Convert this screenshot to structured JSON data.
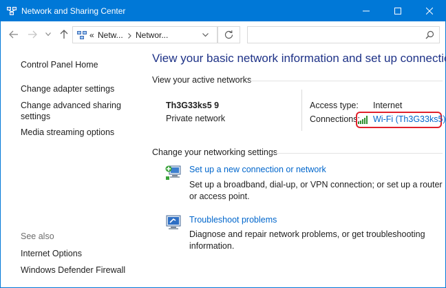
{
  "window": {
    "title": "Network and Sharing Center",
    "accent": "#0078d7"
  },
  "address": {
    "prefix": "«",
    "crumb1": "Netw...",
    "crumb2": "Networ...",
    "search_placeholder": ""
  },
  "sidebar": {
    "items": [
      {
        "label": "Control Panel Home"
      },
      {
        "label": "Change adapter settings"
      },
      {
        "label": "Change advanced sharing settings"
      },
      {
        "label": "Media streaming options"
      }
    ],
    "see_also": "See also",
    "see_also_items": [
      {
        "label": "Internet Options"
      },
      {
        "label": "Windows Defender Firewall"
      }
    ]
  },
  "main": {
    "title": "View your basic network information and set up connections",
    "active_label": "View your active networks",
    "network": {
      "name": "Th3G33ks5 9",
      "category": "Private network",
      "access_type_label": "Access type:",
      "access_type_value": "Internet",
      "connections_label": "Connections:",
      "connection_link": "Wi-Fi (Th3G33ks5)",
      "highlight_color": "#e0212b"
    },
    "change_label": "Change your networking settings",
    "tasks": [
      {
        "icon": "new-connection-icon",
        "link": "Set up a new connection or network",
        "description": "Set up a broadband, dial-up, or VPN connection; or set up a router or access point."
      },
      {
        "icon": "troubleshoot-icon",
        "link": "Troubleshoot problems",
        "description": "Diagnose and repair network problems, or get troubleshooting information."
      }
    ]
  }
}
